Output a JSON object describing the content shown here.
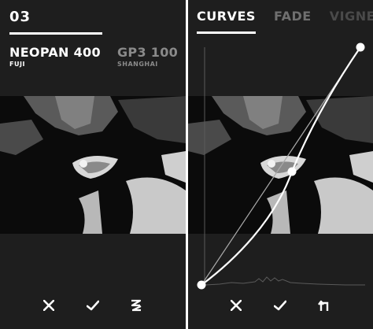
{
  "left_panel": {
    "index": "03",
    "films": [
      {
        "name": "NEOPAN 400",
        "maker": "FUJI",
        "state": "active"
      },
      {
        "name": "GP3 100",
        "maker": "SHANGHAI",
        "state": "inactive"
      }
    ],
    "toolbar": {
      "cancel_icon": "close-icon",
      "confirm_icon": "check-icon",
      "random_icon": "zigzag-icon"
    }
  },
  "right_panel": {
    "tabs": [
      {
        "label": "CURVES",
        "state": "active"
      },
      {
        "label": "FADE",
        "state": "inactive"
      },
      {
        "label": "VIGNET",
        "state": "faded"
      }
    ],
    "toolbar": {
      "cancel_icon": "close-icon",
      "confirm_icon": "check-icon",
      "reset_icon": "undo-arrow-icon"
    }
  },
  "colors": {
    "background": "#1e1e1e",
    "divider": "#ffffff",
    "active_text": "#ffffff",
    "inactive_text": "#8a8a8a"
  }
}
